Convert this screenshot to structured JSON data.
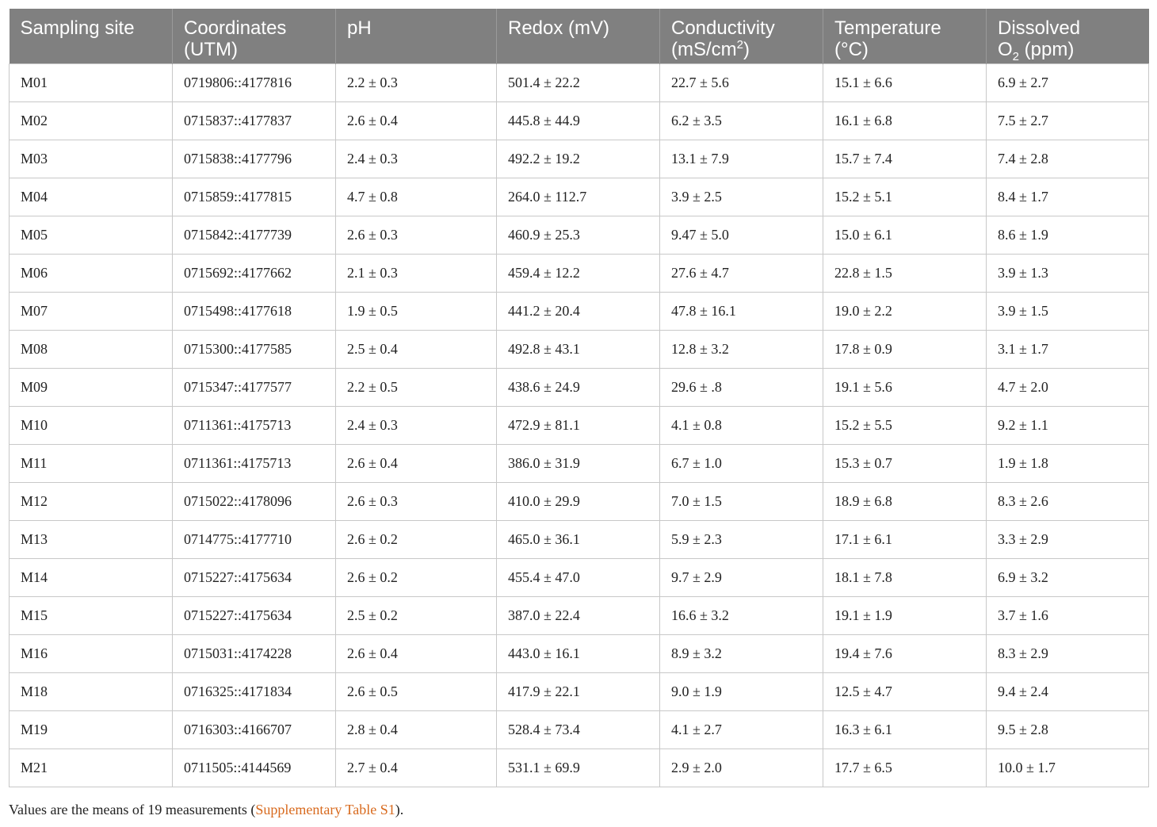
{
  "table": {
    "headers": [
      {
        "line1": "Sampling site",
        "line2": ""
      },
      {
        "line1": "Coordinates",
        "line2": "(UTM)"
      },
      {
        "line1": "pH",
        "line2": ""
      },
      {
        "line1": "Redox (mV)",
        "line2": ""
      },
      {
        "line1": "Conductivity",
        "line2_pre": "(mS/cm",
        "line2_sup": "2",
        "line2_post": ")"
      },
      {
        "line1": "Temperature",
        "line2": "(°C)"
      },
      {
        "line1": "Dissolved",
        "line2_pre": "O",
        "line2_sub": "2",
        "line2_post": " (ppm)"
      }
    ],
    "rows": [
      [
        "M01",
        "0719806::4177816",
        "2.2 ± 0.3",
        "501.4 ± 22.2",
        "22.7 ± 5.6",
        "15.1 ± 6.6",
        "6.9 ± 2.7"
      ],
      [
        "M02",
        "0715837::4177837",
        "2.6 ± 0.4",
        "445.8 ± 44.9",
        "6.2 ± 3.5",
        "16.1 ± 6.8",
        "7.5 ± 2.7"
      ],
      [
        "M03",
        "0715838::4177796",
        "2.4 ± 0.3",
        "492.2 ± 19.2",
        "13.1 ± 7.9",
        "15.7 ± 7.4",
        "7.4 ± 2.8"
      ],
      [
        "M04",
        "0715859::4177815",
        "4.7 ± 0.8",
        "264.0 ± 112.7",
        "3.9 ± 2.5",
        "15.2 ± 5.1",
        "8.4 ± 1.7"
      ],
      [
        "M05",
        "0715842::4177739",
        "2.6 ± 0.3",
        "460.9 ± 25.3",
        "9.47 ± 5.0",
        "15.0 ± 6.1",
        "8.6 ± 1.9"
      ],
      [
        "M06",
        "0715692::4177662",
        "2.1 ± 0.3",
        "459.4 ± 12.2",
        "27.6 ± 4.7",
        "22.8 ± 1.5",
        "3.9 ± 1.3"
      ],
      [
        "M07",
        "0715498::4177618",
        "1.9 ± 0.5",
        "441.2 ± 20.4",
        "47.8 ± 16.1",
        "19.0 ± 2.2",
        "3.9 ± 1.5"
      ],
      [
        "M08",
        "0715300::4177585",
        "2.5 ± 0.4",
        "492.8 ± 43.1",
        "12.8 ± 3.2",
        "17.8 ± 0.9",
        "3.1 ± 1.7"
      ],
      [
        "M09",
        "0715347::4177577",
        "2.2 ± 0.5",
        "438.6 ± 24.9",
        "29.6 ± .8",
        "19.1 ± 5.6",
        "4.7 ± 2.0"
      ],
      [
        "M10",
        "0711361::4175713",
        "2.4 ± 0.3",
        "472.9 ± 81.1",
        "4.1 ± 0.8",
        "15.2 ± 5.5",
        "9.2 ± 1.1"
      ],
      [
        "M11",
        "0711361::4175713",
        "2.6 ± 0.4",
        "386.0 ± 31.9",
        "6.7 ± 1.0",
        "15.3 ± 0.7",
        "1.9 ± 1.8"
      ],
      [
        "M12",
        "0715022::4178096",
        "2.6 ± 0.3",
        "410.0 ± 29.9",
        "7.0 ± 1.5",
        "18.9 ± 6.8",
        "8.3 ± 2.6"
      ],
      [
        "M13",
        "0714775::4177710",
        "2.6 ± 0.2",
        "465.0 ± 36.1",
        "5.9 ± 2.3",
        "17.1 ± 6.1",
        "3.3 ± 2.9"
      ],
      [
        "M14",
        "0715227::4175634",
        "2.6 ± 0.2",
        "455.4 ± 47.0",
        "9.7 ± 2.9",
        "18.1 ± 7.8",
        "6.9 ± 3.2"
      ],
      [
        "M15",
        "0715227::4175634",
        "2.5 ± 0.2",
        "387.0 ± 22.4",
        "16.6 ± 3.2",
        "19.1 ± 1.9",
        "3.7 ± 1.6"
      ],
      [
        "M16",
        "0715031::4174228",
        "2.6 ± 0.4",
        "443.0 ± 16.1",
        "8.9 ± 3.2",
        "19.4 ± 7.6",
        "8.3 ± 2.9"
      ],
      [
        "M18",
        "0716325::4171834",
        "2.6 ± 0.5",
        "417.9 ± 22.1",
        "9.0 ± 1.9",
        "12.5 ± 4.7",
        "9.4 ± 2.4"
      ],
      [
        "M19",
        "0716303::4166707",
        "2.8 ± 0.4",
        "528.4 ± 73.4",
        "4.1 ± 2.7",
        "16.3 ± 6.1",
        "9.5 ± 2.8"
      ],
      [
        "M21",
        "0711505::4144569",
        "2.7 ± 0.4",
        "531.1 ± 69.9",
        "2.9 ± 2.0",
        "17.7 ± 6.5",
        "10.0 ± 1.7"
      ]
    ]
  },
  "caption": {
    "prefix": "Values are the means of 19 measurements (",
    "link": "Supplementary Table S1",
    "suffix": ")."
  },
  "colors": {
    "header_bg": "#808080",
    "header_text": "#ffffff",
    "link": "#d86a1e"
  }
}
